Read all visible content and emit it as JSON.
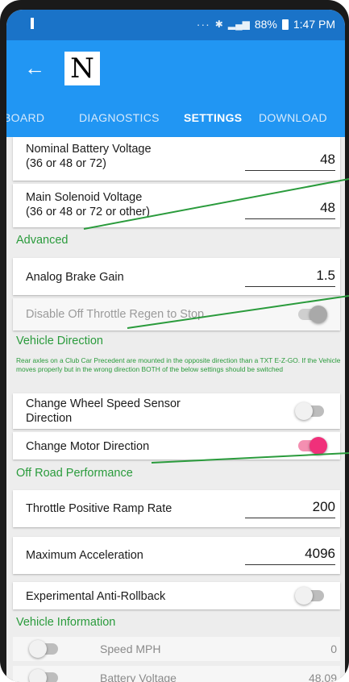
{
  "status_bar": {
    "dots": "···",
    "battery_percent": "88%",
    "time": "1:47 PM"
  },
  "app_bar": {
    "logo_letter": "N"
  },
  "tabs": [
    {
      "label": "BOARD"
    },
    {
      "label": "DIAGNOSTICS"
    },
    {
      "label": "SETTINGS"
    },
    {
      "label": "DOWNLOAD"
    }
  ],
  "settings": {
    "nominal_voltage": {
      "label_line1": "Nominal Battery Voltage",
      "label_line2": "(36 or 48 or 72)",
      "value": "48"
    },
    "solenoid_voltage": {
      "label_line1": "Main Solenoid Voltage",
      "label_line2": "(36 or 48 or 72 or other)",
      "value": "48"
    },
    "advanced_header": "Advanced",
    "analog_brake_gain": {
      "label": "Analog Brake Gain",
      "value": "1.5"
    },
    "disable_regen": {
      "label": "Disable Off Throttle Regen to Stop",
      "state": "on-disabled"
    },
    "vehicle_direction_header": "Vehicle Direction",
    "vehicle_direction_note": "Rear axles on a Club Car Precedent are mounted in the opposite direction than a TXT E-Z-GO. If the Vehicle moves properly but in the wrong direction BOTH of the below settings should be switched",
    "wheel_speed_sensor": {
      "label_line1": "Change Wheel Speed Sensor",
      "label_line2": "Direction",
      "state": "off"
    },
    "motor_direction": {
      "label": "Change Motor Direction",
      "state": "on"
    },
    "off_road_header": "Off Road Performance",
    "throttle_ramp": {
      "label": "Throttle Positive Ramp Rate",
      "value": "200"
    },
    "max_accel": {
      "label": "Maximum Acceleration",
      "value": "4096"
    },
    "anti_rollback": {
      "label": "Experimental Anti-Rollback",
      "state": "off"
    },
    "vehicle_info_header": "Vehicle Information",
    "speed_mph": {
      "label": "Speed MPH",
      "value": "0"
    },
    "battery_voltage": {
      "label": "Battery Voltage",
      "value": "48.09"
    }
  },
  "colors": {
    "status_bar": "#1a73c8",
    "app_bar": "#2196f3",
    "section_green": "#2a9b3c",
    "toggle_on": "#f0307a"
  }
}
